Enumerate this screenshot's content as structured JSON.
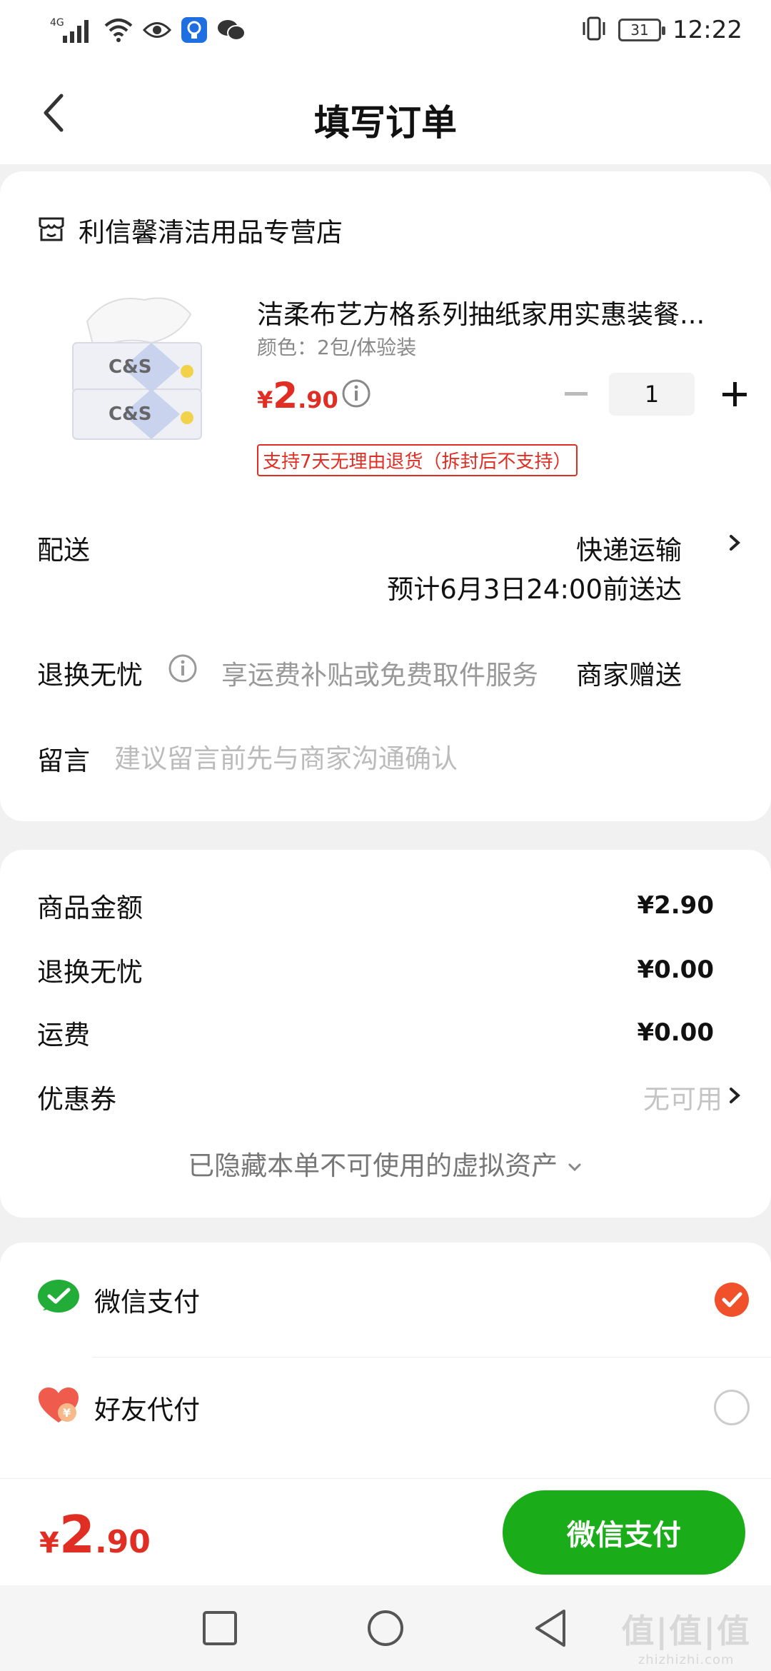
{
  "status_bar": {
    "network": "4G",
    "battery": "31",
    "time": "12:22",
    "icons": [
      "signal-icon",
      "wifi-icon",
      "eye-icon",
      "bulb-app-icon",
      "wechat-notify-icon",
      "vibrate-icon"
    ]
  },
  "header": {
    "title": "填写订单"
  },
  "shop": {
    "name": "利信馨清洁用品专营店"
  },
  "product": {
    "title": "洁柔布艺方格系列抽纸家用实惠装餐...",
    "variant": "颜色：2包/体验装",
    "price_currency": "¥",
    "price_int": "2",
    "price_dec": ".90",
    "quantity": "1",
    "return_policy": "支持7天无理由退货（拆封后不支持）",
    "image_brand": "C&S"
  },
  "delivery": {
    "label": "配送",
    "method": "快递运输",
    "eta": "预计6月3日24:00前送达"
  },
  "return_service": {
    "label": "退换无忧",
    "description": "享运费补贴或免费取件服务",
    "provider": "商家赠送"
  },
  "message": {
    "label": "留言",
    "placeholder": "建议留言前先与商家沟通确认"
  },
  "amounts": {
    "goods_label": "商品金额",
    "goods_value": "¥2.90",
    "return_label": "退换无忧",
    "return_value": "¥0.00",
    "shipping_label": "运费",
    "shipping_value": "¥0.00",
    "coupon_label": "优惠券",
    "coupon_value": "无可用",
    "hidden_assets": "已隐藏本单不可使用的虚拟资产"
  },
  "payment": {
    "wechat_label": "微信支付",
    "wechat_selected": true,
    "friend_label": "好友代付",
    "friend_selected": false
  },
  "bottom": {
    "total_currency": "¥",
    "total_int": "2",
    "total_dec": ".90",
    "pay_button": "微信支付"
  },
  "watermark": {
    "main": "值|值|值",
    "sub": "zhizhizhi.com"
  },
  "colors": {
    "price_red": "#e02e24",
    "wechat_green": "#1aad19",
    "selected_orange": "#f0502a"
  }
}
